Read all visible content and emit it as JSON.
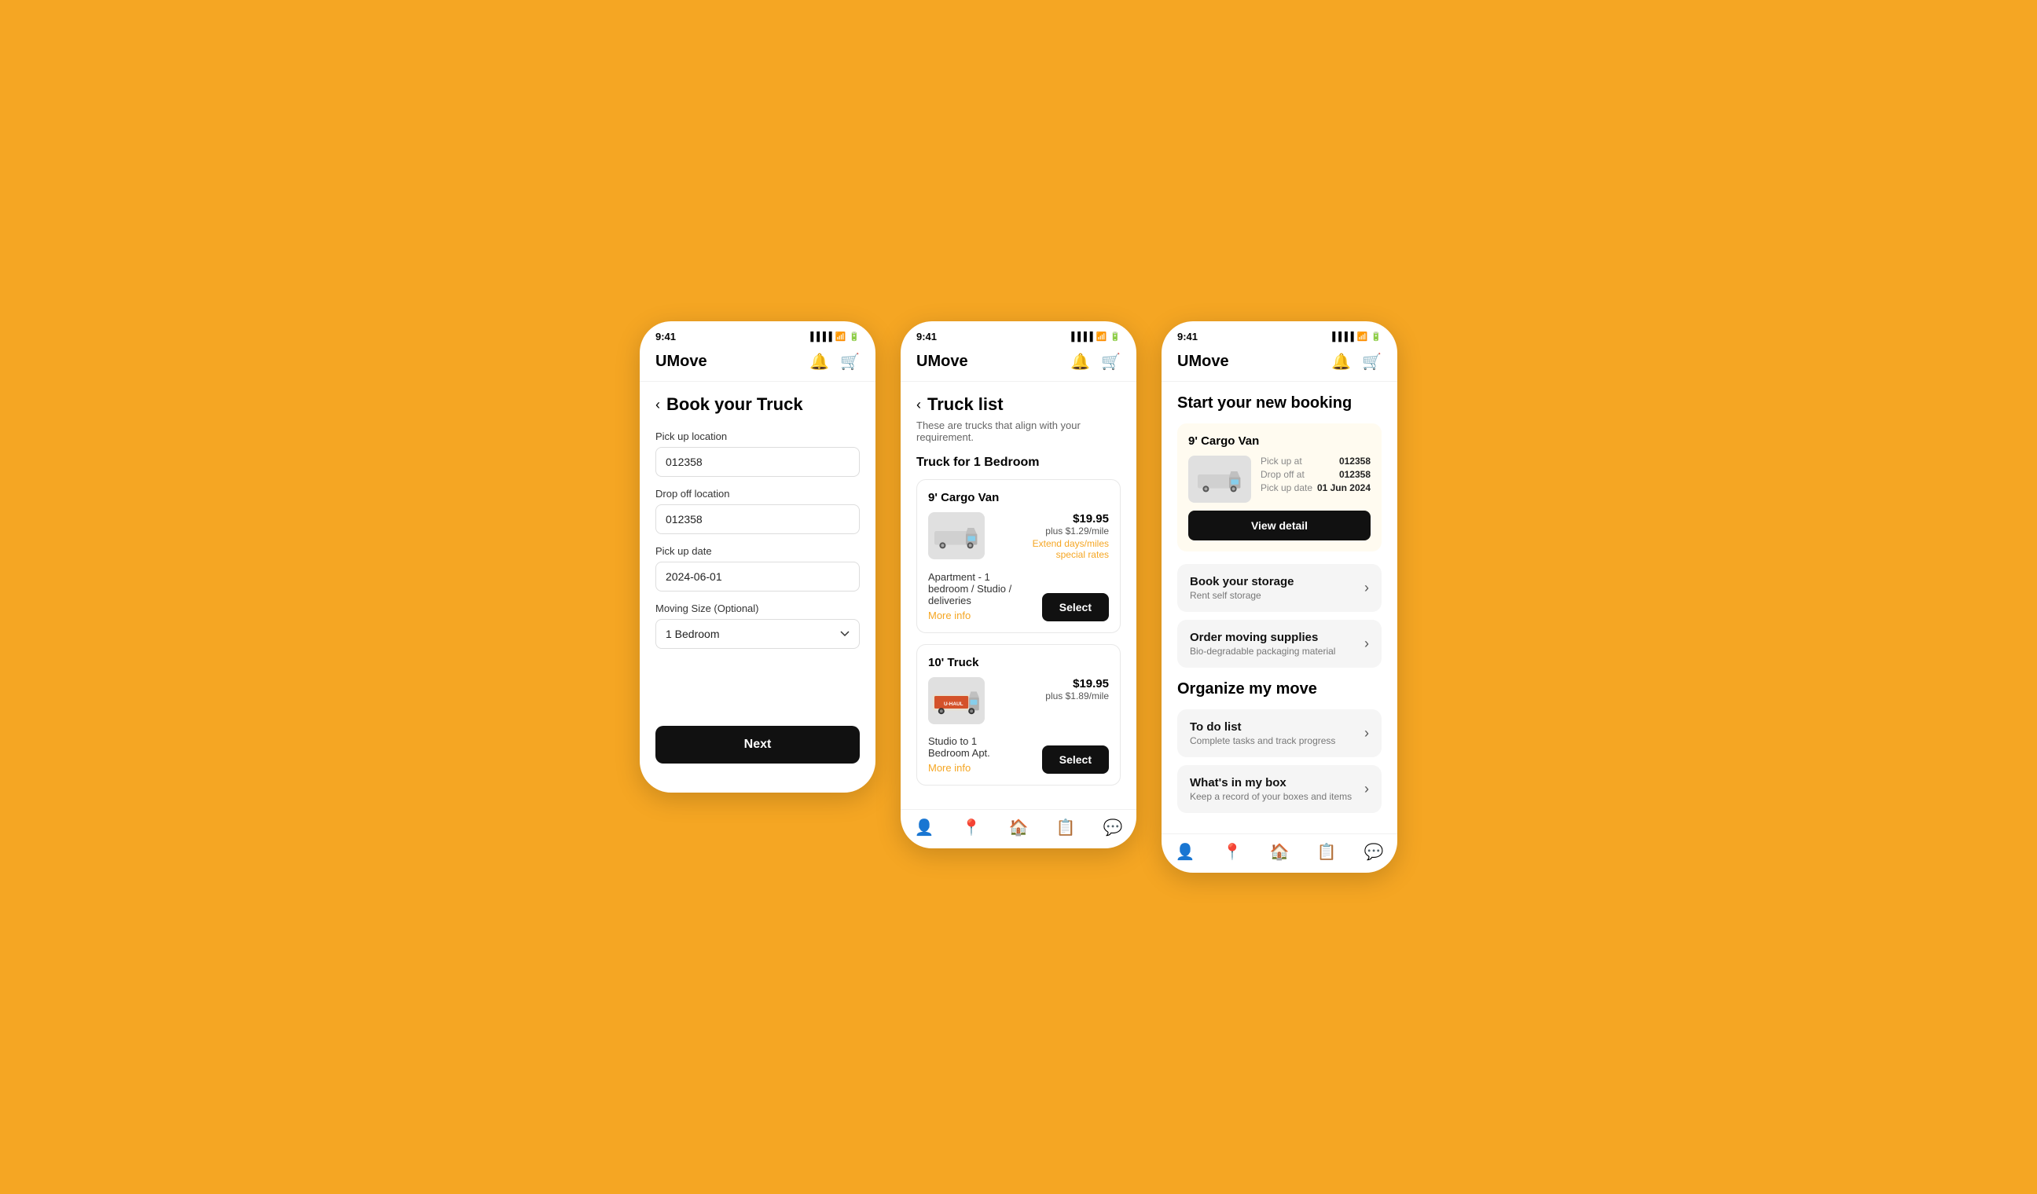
{
  "app": {
    "name": "UMove",
    "time": "9:41"
  },
  "phone1": {
    "page_title": "Book your Truck",
    "pickup_location_label": "Pick up location",
    "pickup_location_value": "012358",
    "dropoff_location_label": "Drop off location",
    "dropoff_location_value": "012358",
    "pickup_date_label": "Pick up date",
    "pickup_date_value": "2024-06-01",
    "moving_size_label": "Moving Size (Optional)",
    "moving_size_value": "1 Bedroom",
    "next_btn_label": "Next"
  },
  "phone2": {
    "page_title": "Truck list",
    "subtitle": "These are trucks that align with your requirement.",
    "section_title": "Truck for 1 Bedroom",
    "trucks": [
      {
        "name": "9' Cargo Van",
        "price_main": "$19.95",
        "price_sub": "plus $1.29/mile",
        "price_extend": "Extend days/miles special rates",
        "desc": "Apartment - 1 bedroom / Studio / deliveries",
        "more_info": "More info",
        "select_label": "Select"
      },
      {
        "name": "10' Truck",
        "price_main": "$19.95",
        "price_sub": "plus $1.89/mile",
        "price_extend": "",
        "desc": "Studio to 1 Bedroom Apt.",
        "more_info": "More info",
        "select_label": "Select"
      }
    ]
  },
  "phone3": {
    "section1_title": "Start your new booking",
    "booking_title": "9' Cargo Van",
    "pickup_at_label": "Pick up at",
    "pickup_at_value": "012358",
    "dropoff_at_label": "Drop off at",
    "dropoff_at_value": "012358",
    "pickup_date_label": "Pick up date",
    "pickup_date_value": "01 Jun 2024",
    "view_detail_label": "View detail",
    "menu_items": [
      {
        "title": "Book your storage",
        "subtitle": "Rent self storage"
      },
      {
        "title": "Order moving supplies",
        "subtitle": "Bio-degradable packaging material"
      }
    ],
    "section2_title": "Organize my move",
    "organize_items": [
      {
        "title": "To do list",
        "subtitle": "Complete tasks and track progress"
      },
      {
        "title": "What's in my box",
        "subtitle": "Keep a record of your boxes and items"
      }
    ]
  },
  "bottom_nav": [
    {
      "icon": "👤",
      "label": "profile",
      "active": false
    },
    {
      "icon": "📍",
      "label": "location",
      "active": false
    },
    {
      "icon": "🏠",
      "label": "home",
      "active": true
    },
    {
      "icon": "📋",
      "label": "tasks",
      "active": false
    },
    {
      "icon": "💬",
      "label": "chat",
      "active": false
    }
  ]
}
